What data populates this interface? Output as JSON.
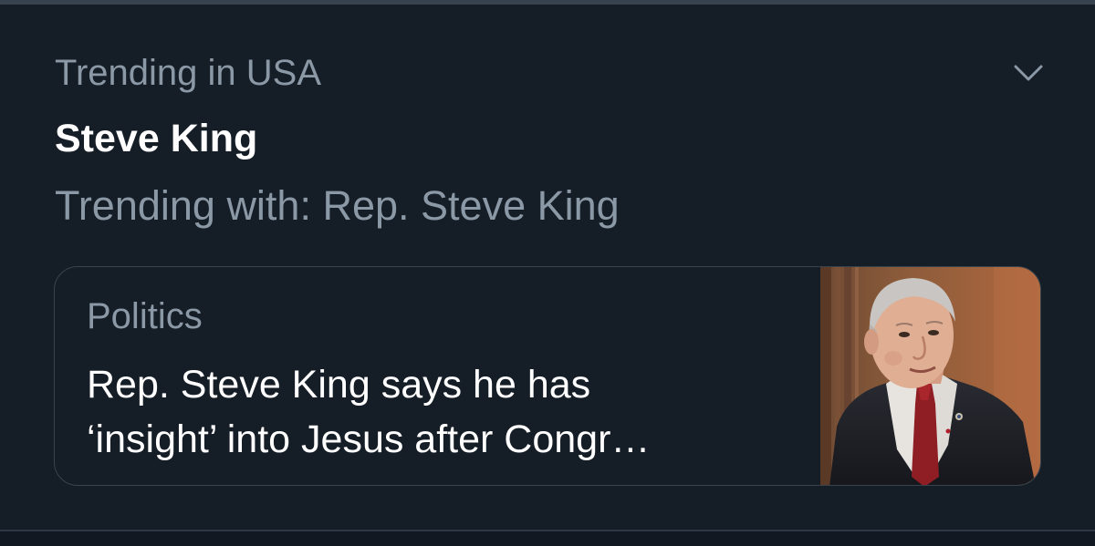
{
  "trend": {
    "context": "Trending in USA",
    "title": "Steve King",
    "trending_with": "Trending with: Rep. Steve King",
    "menu_icon": "chevron-down-icon"
  },
  "card": {
    "category": "Politics",
    "headline_lines": [
      "Rep. Steve King says he has",
      "‘insight’ into Jesus after Congr…"
    ],
    "thumbnail_alt": "photo of man in suit"
  },
  "colors": {
    "background": "#151d27",
    "primary_text": "#ffffff",
    "secondary_text": "#8b98a5",
    "border": "#38444d"
  }
}
